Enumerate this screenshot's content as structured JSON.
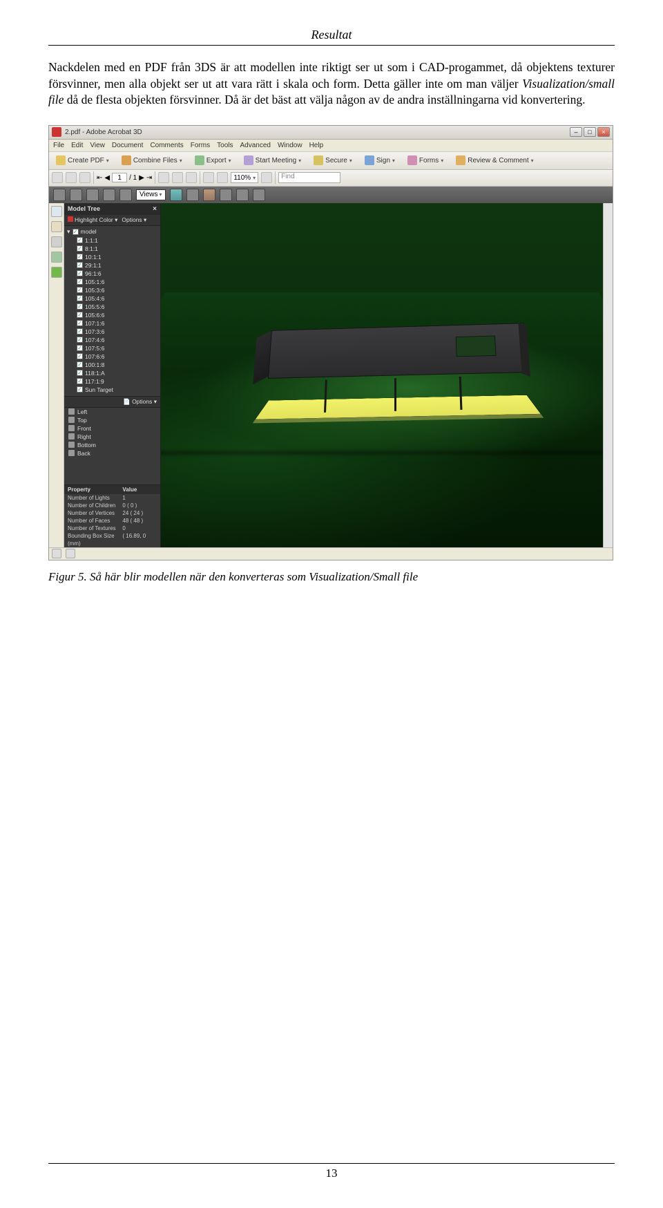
{
  "doc": {
    "header": "Resultat",
    "paragraph_before": "Nackdelen med en PDF från 3DS är att modellen inte riktigt ser ut som i CAD-progammet, då objektens texturer försvinner, men alla objekt ser ut att vara rätt i skala och form. Detta gäller inte om man väljer ",
    "italic_phrase": "Visualization/small file",
    "paragraph_after": " då de flesta objekten försvinner. Då är det bäst att välja någon av de andra inställningarna vid konvertering.",
    "caption": "Figur 5. Så här blir modellen när den konverteras som Visualization/Small file",
    "page_number": "13"
  },
  "app": {
    "window_title": "2.pdf - Adobe Acrobat 3D",
    "menu": [
      "File",
      "Edit",
      "View",
      "Document",
      "Comments",
      "Forms",
      "Tools",
      "Advanced",
      "Window",
      "Help"
    ],
    "toolbar": {
      "create": "Create PDF",
      "combine": "Combine Files",
      "export": "Export",
      "meeting": "Start Meeting",
      "secure": "Secure",
      "sign": "Sign",
      "forms": "Forms",
      "review": "Review & Comment"
    },
    "nav": {
      "page_current": "1",
      "page_total": "/ 1",
      "zoom": "110%",
      "find_placeholder": "Find"
    },
    "tb3": {
      "views_label": "Views"
    },
    "panel": {
      "title": "Model Tree",
      "highlight": "Highlight Color",
      "options": "Options",
      "root": "model",
      "tree": [
        "1:1:1",
        "8:1:1",
        "10:1:1",
        "29:1:1",
        "96:1:6",
        "105:1:6",
        "105:3:6",
        "105:4:6",
        "105:5:6",
        "105:6:6",
        "107:1:6",
        "107:3:6",
        "107:4:6",
        "107:5:6",
        "107:6:6",
        "100:1:8",
        "118:1:A",
        "117:1:9",
        "Sun Target"
      ],
      "views": [
        "Left",
        "Top",
        "Front",
        "Right",
        "Bottom",
        "Back"
      ],
      "props_header": [
        "Property",
        "Value"
      ],
      "props": [
        [
          "Number of Lights",
          "1"
        ],
        [
          "Number of Children",
          "0 ( 0 )"
        ],
        [
          "Number of Vertices",
          "24 ( 24 )"
        ],
        [
          "Number of Faces",
          "48 ( 48 )"
        ],
        [
          "Number of Textures",
          "0"
        ],
        [
          "Bounding Box Size (mm)",
          "( 16.89, 0"
        ]
      ]
    }
  }
}
